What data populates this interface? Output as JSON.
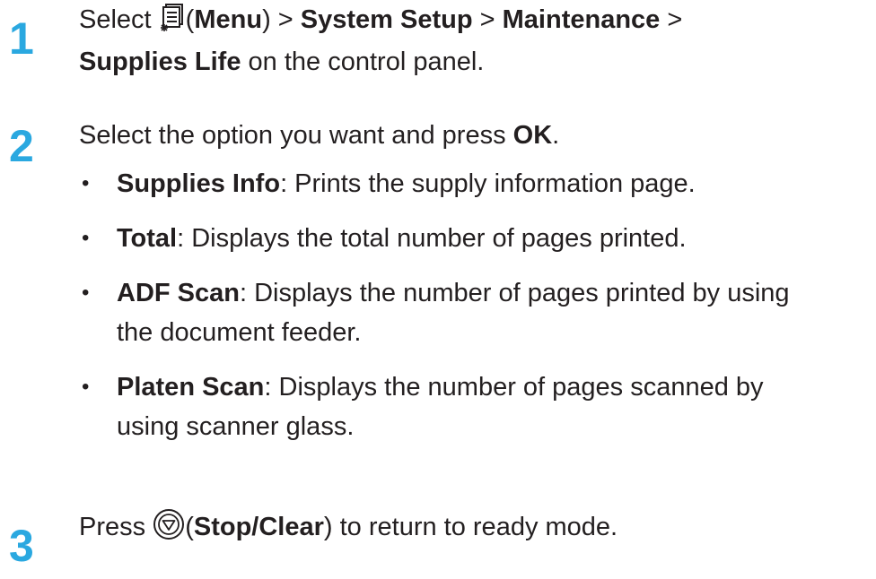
{
  "step1": {
    "number": "1",
    "select_word": "Select ",
    "paren_open": "(",
    "menu_label": "Menu",
    "after_menu": ") > ",
    "system_setup": "System Setup",
    "sep1": " > ",
    "maintenance": "Maintenance",
    "sep2": " >",
    "supplies_life": "Supplies Life",
    "tail": " on the control panel.",
    "icon": "menu-icon"
  },
  "step2": {
    "number": "2",
    "text_pre": "Select the option you want and press ",
    "ok": "OK",
    "text_post": ".",
    "bullets": [
      {
        "term": "Supplies Info",
        "desc": ": Prints the supply information page.",
        "desc2": ""
      },
      {
        "term": "Total",
        "desc": ": Displays the total number of pages printed.",
        "desc2": ""
      },
      {
        "term": "ADF Scan",
        "desc": ": Displays the number of pages printed by using",
        "desc2": "the document feeder."
      },
      {
        "term": "Platen Scan",
        "desc": ": Displays the number of pages scanned by",
        "desc2": "using scanner glass."
      }
    ]
  },
  "step3": {
    "number": "3",
    "press": "Press ",
    "paren_open": "(",
    "stop_clear": "Stop/Clear",
    "tail": ") to return to ready mode.",
    "icon": "stop-clear-icon"
  },
  "colors": {
    "step_number": "#2aa8e0",
    "text": "#231f20"
  }
}
